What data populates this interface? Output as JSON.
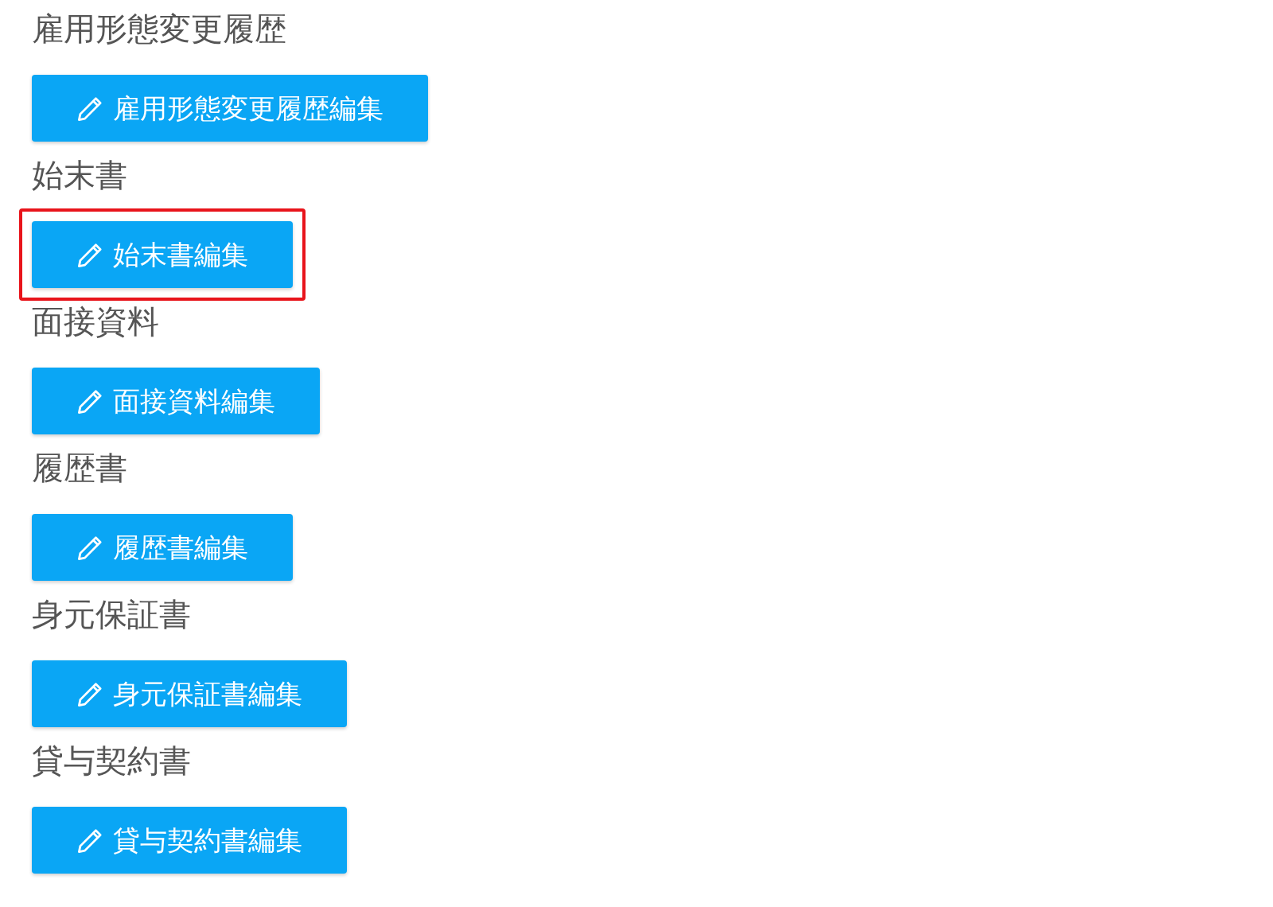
{
  "sections": [
    {
      "title": "雇用形態変更履歴",
      "button": "雇用形態変更履歴編集",
      "highlighted": false
    },
    {
      "title": "始末書",
      "button": "始末書編集",
      "highlighted": true
    },
    {
      "title": "面接資料",
      "button": "面接資料編集",
      "highlighted": false
    },
    {
      "title": "履歴書",
      "button": "履歴書編集",
      "highlighted": false
    },
    {
      "title": "身元保証書",
      "button": "身元保証書編集",
      "highlighted": false
    },
    {
      "title": "貸与契約書",
      "button": "貸与契約書編集",
      "highlighted": false
    }
  ]
}
